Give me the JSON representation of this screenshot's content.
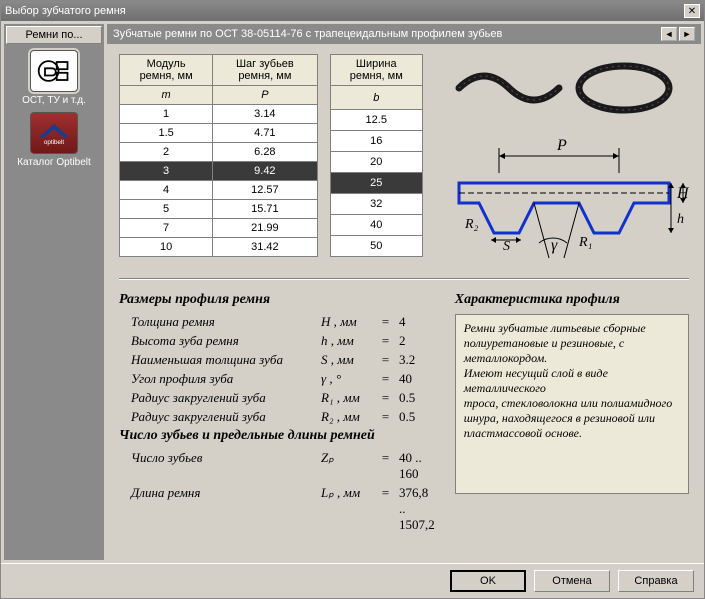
{
  "window": {
    "title": "Выбор зубчатого ремня"
  },
  "sidebar": {
    "header": "Ремни по...",
    "items": [
      {
        "label": "ОСТ, ТУ и т.д."
      },
      {
        "label": "Каталог Optibelt"
      }
    ]
  },
  "subtitle": "Зубчатые ремни по ОСТ 38-05114-76 с трапецеидальным профилем зубьев",
  "table1": {
    "h1": "Модуль ремня, мм",
    "h2": "Шаг зубьев ремня, мм",
    "s1": "m",
    "s2": "P",
    "rows": [
      {
        "m": "1",
        "p": "3.14"
      },
      {
        "m": "1.5",
        "p": "4.71"
      },
      {
        "m": "2",
        "p": "6.28"
      },
      {
        "m": "3",
        "p": "9.42",
        "sel": true
      },
      {
        "m": "4",
        "p": "12.57"
      },
      {
        "m": "5",
        "p": "15.71"
      },
      {
        "m": "7",
        "p": "21.99"
      },
      {
        "m": "10",
        "p": "31.42"
      }
    ]
  },
  "table2": {
    "h1": "Ширина ремня, мм",
    "s1": "b",
    "rows": [
      {
        "b": "12.5"
      },
      {
        "b": "16"
      },
      {
        "b": "20"
      },
      {
        "b": "25",
        "sel": true
      },
      {
        "b": "32"
      },
      {
        "b": "40"
      },
      {
        "b": "50"
      }
    ]
  },
  "profile": {
    "title": "Размеры профиля ремня",
    "rows": [
      {
        "lbl": "Толщина ремня",
        "sym": "H , мм",
        "val": "4"
      },
      {
        "lbl": "Высота зуба ремня",
        "sym": "h , мм",
        "val": "2"
      },
      {
        "lbl": "Наименьшая толщина зуба",
        "sym": "S , мм",
        "val": "3.2"
      },
      {
        "lbl": "Угол профиля зуба",
        "sym": "γ , °",
        "val": "40"
      },
      {
        "lbl": "Радиус закруглений зуба",
        "sym": "R₁ , мм",
        "val": "0.5"
      },
      {
        "lbl": "Радиус закруглений зуба",
        "sym": "R₂ , мм",
        "val": "0.5"
      }
    ],
    "title2": "Число зубьев и предельные длины ремней",
    "rows2": [
      {
        "lbl": "Число зубьев",
        "sym": "Zₚ",
        "val": "40 .. 160"
      },
      {
        "lbl": "Длина ремня",
        "sym": "Lₚ , мм",
        "val": "376,8 .. 1507,2"
      }
    ]
  },
  "charac": {
    "title": "Характеристика профиля",
    "text": "Ремни зубчатые литьевые сборные полиуретановые и резиновые, с металлокордом.\nИмеют несущий слой в виде металлического\nтроса, стекловолокна или полиамидного\nшнура, находящегося в резиновой или пластмассовой основе."
  },
  "buttons": {
    "ok": "OK",
    "cancel": "Отмена",
    "help": "Справка"
  }
}
